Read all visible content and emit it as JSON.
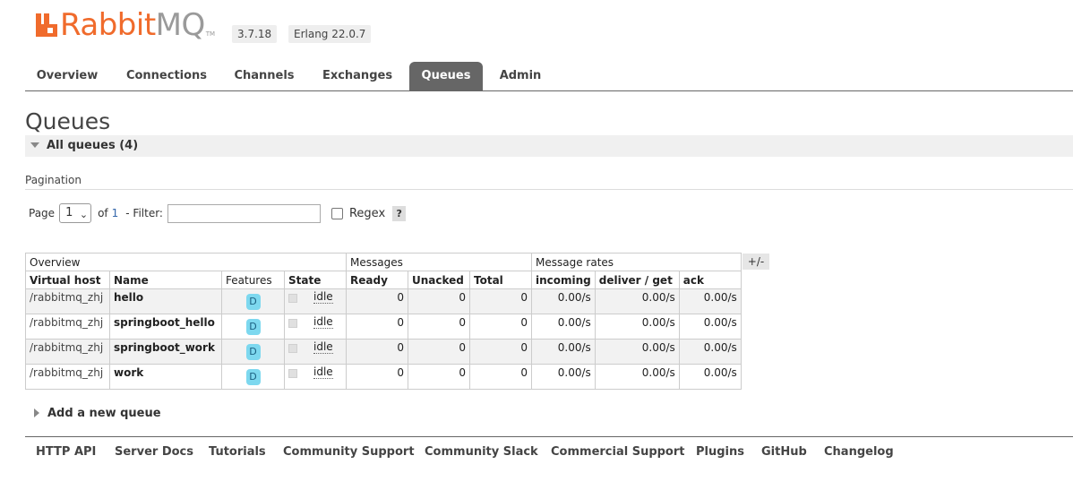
{
  "header": {
    "logo_rabbit": "Rabbit",
    "logo_mq": "MQ",
    "logo_tm": "TM",
    "version": "3.7.18",
    "erlang": "Erlang 22.0.7"
  },
  "tabs": [
    {
      "label": "Overview"
    },
    {
      "label": "Connections"
    },
    {
      "label": "Channels"
    },
    {
      "label": "Exchanges"
    },
    {
      "label": "Queues",
      "active": true
    },
    {
      "label": "Admin"
    }
  ],
  "page": {
    "title": "Queues",
    "section": "All queues (4)"
  },
  "pagination": {
    "label": "Pagination",
    "page_label": "Page",
    "page_value": "1",
    "of_label": "of",
    "of_value": "1",
    "filter_label": "- Filter:",
    "filter_value": "",
    "regex_label": "Regex",
    "help": "?"
  },
  "table": {
    "groups": [
      "Overview",
      "Messages",
      "Message rates"
    ],
    "columns": [
      "Virtual host",
      "Name",
      "Features",
      "State",
      "Ready",
      "Unacked",
      "Total",
      "incoming",
      "deliver / get",
      "ack"
    ],
    "toggle": "+/-",
    "rows": [
      {
        "vhost": "/rabbitmq_zhj",
        "name": "hello",
        "feature": "D",
        "state": "idle",
        "ready": "0",
        "unacked": "0",
        "total": "0",
        "incoming": "0.00/s",
        "deliver": "0.00/s",
        "ack": "0.00/s"
      },
      {
        "vhost": "/rabbitmq_zhj",
        "name": "springboot_hello",
        "feature": "D",
        "state": "idle",
        "ready": "0",
        "unacked": "0",
        "total": "0",
        "incoming": "0.00/s",
        "deliver": "0.00/s",
        "ack": "0.00/s"
      },
      {
        "vhost": "/rabbitmq_zhj",
        "name": "springboot_work",
        "feature": "D",
        "state": "idle",
        "ready": "0",
        "unacked": "0",
        "total": "0",
        "incoming": "0.00/s",
        "deliver": "0.00/s",
        "ack": "0.00/s"
      },
      {
        "vhost": "/rabbitmq_zhj",
        "name": "work",
        "feature": "D",
        "state": "idle",
        "ready": "0",
        "unacked": "0",
        "total": "0",
        "incoming": "0.00/s",
        "deliver": "0.00/s",
        "ack": "0.00/s"
      }
    ]
  },
  "add_queue": "Add a new queue",
  "footer": [
    "HTTP API",
    "Server Docs",
    "Tutorials",
    "Community Support",
    "Community Slack",
    "Commercial Support",
    "Plugins",
    "GitHub",
    "Changelog"
  ],
  "colors": {
    "brand_orange": "#f06b2c",
    "logo_grey": "#9a9a9a",
    "active_tab": "#666666",
    "feature_badge": "#7dd8ef"
  }
}
